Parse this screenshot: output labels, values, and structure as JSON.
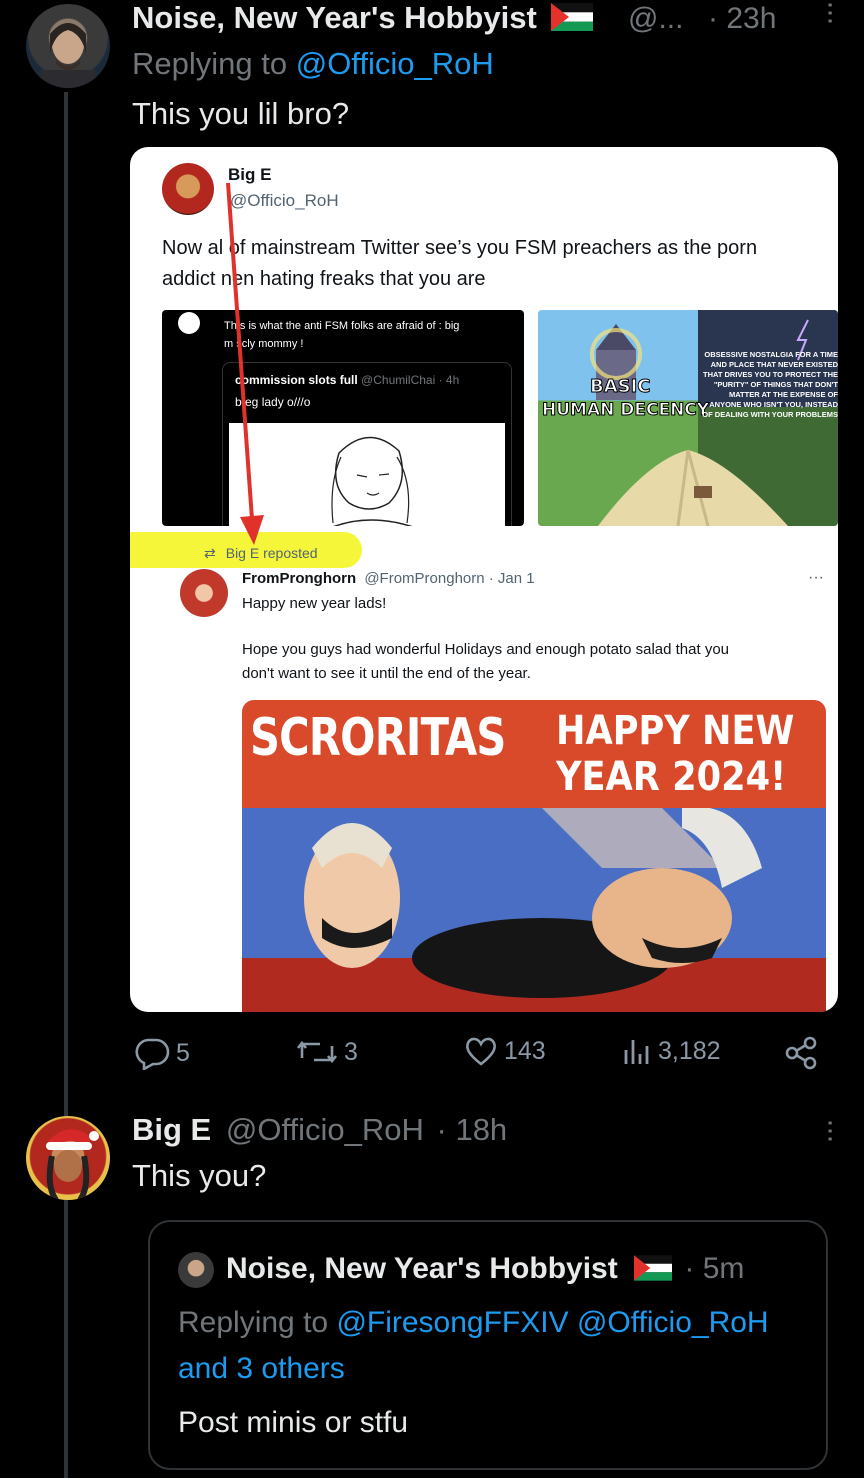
{
  "tweet1": {
    "display_name": "Noise, New Year's Hobbyist",
    "handle": "@...",
    "time": "· 23h",
    "replying_prefix": "Replying to ",
    "replying_handle": "@Officio_RoH",
    "text": "This you lil bro?"
  },
  "embedded": {
    "name": "Big E",
    "handle": "@Officio_RoH",
    "text_line1": "Now al  of mainstream Twitter see’s you FSM preachers as the porn",
    "text_line2": "addict  nen hating freaks that you are",
    "left_img": {
      "caption1": "Th s is what the anti FSM folks are afraid of : big",
      "caption2": "m scly mommy !",
      "inner_name": "commission slots full",
      "inner_handle": "@ChumilChai · 4h",
      "inner_text": "b eg lady o///o"
    },
    "meme": {
      "left_label1": "BASIC",
      "left_label2": "HUMAN DECENCY",
      "right_label": "OBSESSIVE NOSTALGIA FOR A TIME AND PLACE THAT NEVER EXISTED THAT DRIVES YOU TO PROTECT THE \"PURITY\" OF THINGS THAT DON'T MATTER AT THE EXPENSE OF ANYONE WHO ISN'T YOU, INSTEAD OF DEALING WITH YOUR PROBLEMS"
    },
    "reposted": "Big E reposted",
    "repost_name": "FromPronghorn",
    "repost_handle": "@FromPronghorn · Jan 1",
    "repost_line1": "Happy new year lads!",
    "repost_line2": "Hope you guys had wonderful Holidays and enough potato salad that you",
    "repost_line3": "don't want to see it until the end of the year.",
    "banner_left": "SCRORITAS",
    "banner_right1": "HAPPY NEW",
    "banner_right2": "YEAR 2024!"
  },
  "actions": {
    "replies": "5",
    "reposts": "3",
    "likes": "143",
    "views": "3,182"
  },
  "tweet2": {
    "display_name": "Big E",
    "handle": "@Officio_RoH",
    "time": "· 18h",
    "text": "This you?"
  },
  "quote": {
    "display_name": "Noise, New Year's Hobbyist",
    "time": "· 5m",
    "replying_prefix": "Replying to ",
    "replying_handles": "@FiresongFFXIV @Officio_RoH",
    "replying_others": "and 3 others",
    "text": "Post minis or stfu"
  },
  "colors": {
    "background": "#000000",
    "link": "#1d9bf0",
    "muted": "#71767b",
    "highlight": "#f5f53a",
    "arrow": "#e0322a"
  }
}
